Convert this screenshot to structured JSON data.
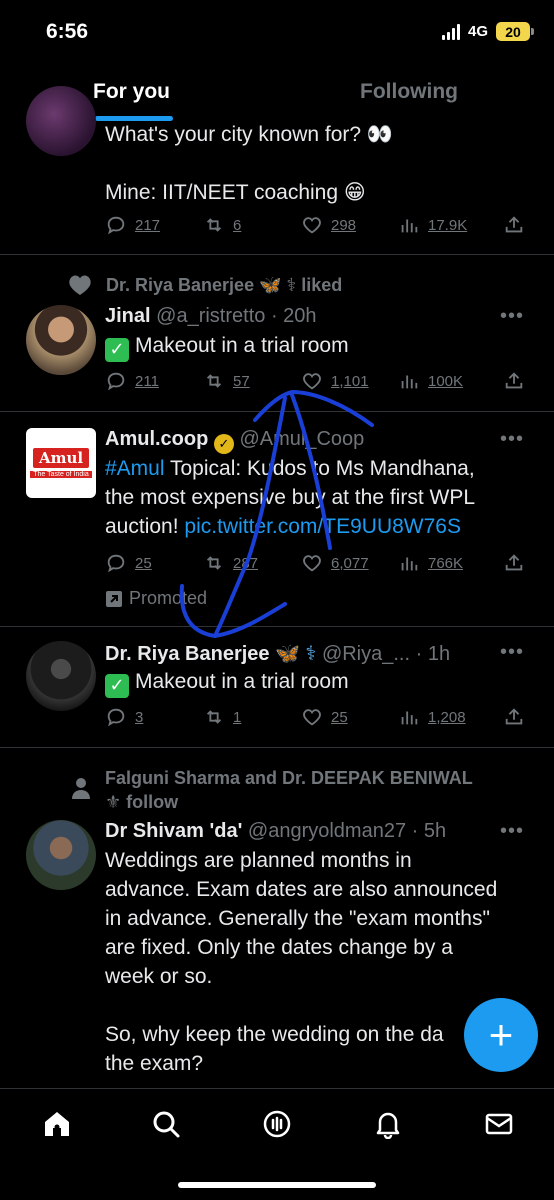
{
  "status_bar": {
    "time": "6:56",
    "network": "4G",
    "battery": "20"
  },
  "tabs": [
    {
      "label": "For you",
      "active": true
    },
    {
      "label": "Following",
      "active": false
    }
  ],
  "tweets": [
    {
      "body_lines": [
        "What's your city known for? 👀",
        "",
        "Mine: IIT/NEET coaching 😁"
      ],
      "replies": "217",
      "retweets": "6",
      "likes": "298",
      "views": "17.9K"
    },
    {
      "social_context": "Dr. Riya Banerjee 🦋 ⚕ liked",
      "name": "Jinal",
      "handle": "@a_ristretto",
      "time": "· 20h",
      "body": "Makeout in a trial room",
      "replies": "211",
      "retweets": "57",
      "likes": "1,101",
      "views": "100K"
    },
    {
      "name": "Amul.coop",
      "handle": "@Amul_Coop",
      "hashtag": "#Amul",
      "body_1": " Topical: Kudos to Ms Mandhana,",
      "body_2": "the most expensive buy at the first WPL",
      "body_3": "auction! ",
      "link": "pic.twitter.com/TE9UU8W76S",
      "replies": "25",
      "retweets": "287",
      "likes": "6,077",
      "views": "766K",
      "promoted": "Promoted",
      "logo_text": "Amul",
      "logo_tagline": "The Taste of India"
    },
    {
      "name": "Dr. Riya Banerjee",
      "name_suffix": "🦋 ⚕",
      "handle": "@Riya_...",
      "time": "· 1h",
      "body": "Makeout in a trial room",
      "replies": "3",
      "retweets": "1",
      "likes": "25",
      "views": "1,208"
    },
    {
      "social_line_1": "Falguni Sharma and Dr. DEEPAK BENIWAL",
      "social_line_2": "⚜ follow",
      "name": "Dr Shivam 'da'",
      "handle": "@angryoldman27",
      "time": "· 5h",
      "body_lines": [
        "Weddings are planned months in",
        "advance. Exam dates are also announced",
        "in advance. Generally the \"exam months\"",
        "are fixed. Only the dates change by a",
        "week or so.",
        "",
        "So, why keep the wedding on the da",
        "the exam?"
      ]
    }
  ],
  "more_glyph": "•••",
  "fab_label": "+",
  "colors": {
    "accent": "#1d9bf0",
    "muted": "#71767b",
    "annotation": "#1a3fd6"
  },
  "icons": [
    "home-icon",
    "search-icon",
    "spaces-icon",
    "bell-icon",
    "mail-icon"
  ]
}
